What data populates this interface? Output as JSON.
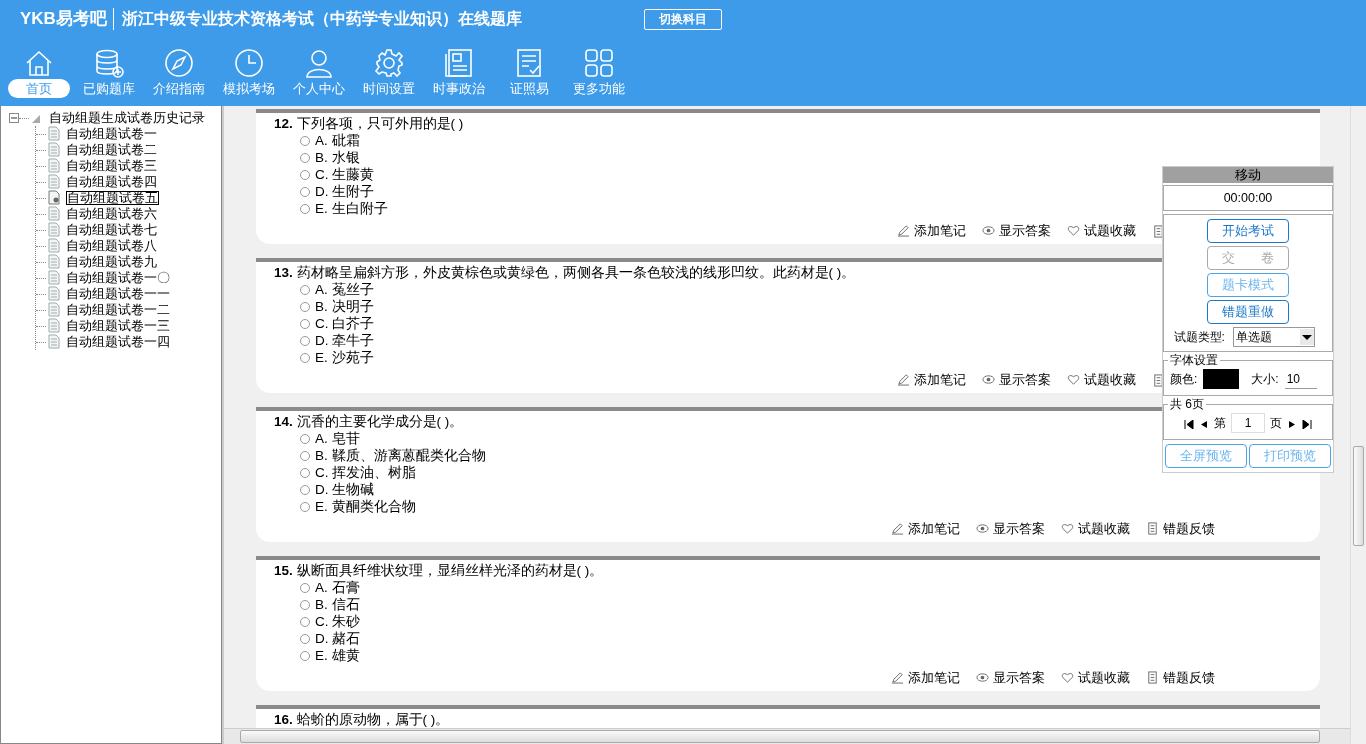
{
  "app": {
    "logo": "YKB易考吧",
    "title": "浙江中级专业技术资格考试（中药学专业知识）在线题库",
    "switch_button": "切换科目"
  },
  "nav": [
    {
      "kind": "home",
      "label": "首页",
      "selected": true
    },
    {
      "kind": "database",
      "label": "已购题库",
      "selected": false
    },
    {
      "kind": "compass",
      "label": "介绍指南",
      "selected": false
    },
    {
      "kind": "clock",
      "label": "模拟考场",
      "selected": false
    },
    {
      "kind": "person",
      "label": "个人中心",
      "selected": false
    },
    {
      "kind": "gear",
      "label": "时间设置",
      "selected": false
    },
    {
      "kind": "news",
      "label": "时事政治",
      "selected": false
    },
    {
      "kind": "checklist",
      "label": "证照易",
      "selected": false
    },
    {
      "kind": "grid",
      "label": "更多功能",
      "selected": false
    }
  ],
  "tree": {
    "label": "自动组题生成试卷历史记录",
    "expanded": true,
    "children": [
      {
        "label": "自动组题试卷一",
        "selected": false
      },
      {
        "label": "自动组题试卷二",
        "selected": false
      },
      {
        "label": "自动组题试卷三",
        "selected": false
      },
      {
        "label": "自动组题试卷四",
        "selected": false
      },
      {
        "label": "自动组题试卷五",
        "selected": true
      },
      {
        "label": "自动组题试卷六",
        "selected": false
      },
      {
        "label": "自动组题试卷七",
        "selected": false
      },
      {
        "label": "自动组题试卷八",
        "selected": false
      },
      {
        "label": "自动组题试卷九",
        "selected": false
      },
      {
        "label": "自动组题试卷一〇",
        "selected": false
      },
      {
        "label": "自动组题试卷一一",
        "selected": false
      },
      {
        "label": "自动组题试卷一二",
        "selected": false
      },
      {
        "label": "自动组题试卷一三",
        "selected": false
      },
      {
        "label": "自动组题试卷一四",
        "selected": false
      }
    ]
  },
  "questions": [
    {
      "number": "12.",
      "text": "下列各项，只可外用的是( )",
      "options": [
        {
          "letter": "A.",
          "text": "砒霜",
          "checked": false
        },
        {
          "letter": "B.",
          "text": "水银",
          "checked": false
        },
        {
          "letter": "C.",
          "text": "生藤黄",
          "checked": false
        },
        {
          "letter": "D.",
          "text": "生附子",
          "checked": false
        },
        {
          "letter": "E.",
          "text": "生白附子",
          "checked": false
        }
      ],
      "actions": [
        {
          "kind": "note",
          "label": "添加笔记"
        },
        {
          "kind": "answer",
          "label": "显示答案"
        },
        {
          "kind": "favorite",
          "label": "试题收藏"
        },
        {
          "kind": "feedback"
        }
      ]
    },
    {
      "number": "13.",
      "text": "药材略呈扁斜方形，外皮黄棕色或黄绿色，两侧各具一条色较浅的线形凹纹。此药材是( )。",
      "options": [
        {
          "letter": "A.",
          "text": "菟丝子",
          "checked": false
        },
        {
          "letter": "B.",
          "text": "决明子",
          "checked": false
        },
        {
          "letter": "C.",
          "text": "白芥子",
          "checked": false
        },
        {
          "letter": "D.",
          "text": "牵牛子",
          "checked": false
        },
        {
          "letter": "E.",
          "text": "沙苑子",
          "checked": false
        }
      ],
      "actions": [
        {
          "kind": "note",
          "label": "添加笔记"
        },
        {
          "kind": "answer",
          "label": "显示答案"
        },
        {
          "kind": "favorite",
          "label": "试题收藏"
        },
        {
          "kind": "feedback"
        }
      ]
    },
    {
      "number": "14.",
      "text": "沉香的主要化学成分是( )。",
      "options": [
        {
          "letter": "A.",
          "text": "皂苷",
          "checked": false
        },
        {
          "letter": "B.",
          "text": "鞣质、游离蒽醌类化合物",
          "checked": false
        },
        {
          "letter": "C.",
          "text": "挥发油、树脂",
          "checked": false
        },
        {
          "letter": "D.",
          "text": "生物碱",
          "checked": false
        },
        {
          "letter": "E.",
          "text": "黄酮类化合物",
          "checked": false
        }
      ],
      "actions": [
        {
          "kind": "note",
          "label": "添加笔记"
        },
        {
          "kind": "answer",
          "label": "显示答案"
        },
        {
          "kind": "favorite",
          "label": "试题收藏"
        },
        {
          "kind": "feedback",
          "label": "错题反馈"
        }
      ]
    },
    {
      "number": "15.",
      "text": "纵断面具纤维状纹理，显绢丝样光泽的药材是( )。",
      "options": [
        {
          "letter": "A.",
          "text": "石膏",
          "checked": false
        },
        {
          "letter": "B.",
          "text": "信石",
          "checked": false
        },
        {
          "letter": "C.",
          "text": "朱砂",
          "checked": false
        },
        {
          "letter": "D.",
          "text": "赭石",
          "checked": false
        },
        {
          "letter": "E.",
          "text": "雄黄",
          "checked": false
        }
      ],
      "actions": [
        {
          "kind": "note",
          "label": "添加笔记"
        },
        {
          "kind": "answer",
          "label": "显示答案"
        },
        {
          "kind": "favorite",
          "label": "试题收藏"
        },
        {
          "kind": "feedback",
          "label": "错题反馈"
        }
      ]
    },
    {
      "number": "16.",
      "text": "蛤蚧的原动物，属于( )。"
    }
  ],
  "panel": {
    "title": "移动",
    "timer": "00:00:00",
    "buttons": [
      {
        "label": "开始考试",
        "active": true,
        "disabled": false
      },
      {
        "label": "交　　卷",
        "active": false,
        "disabled": true
      },
      {
        "label": "题卡模式",
        "active": false,
        "disabled": false
      },
      {
        "label": "错题重做",
        "active": true,
        "disabled": false
      }
    ],
    "type_label": "试题类型:",
    "type_value": "单选题",
    "font_group": "字体设置",
    "color_label": "颜色:",
    "size_label": "大小:",
    "size_value": "10",
    "pages_group": "共 6页",
    "page_prefix": "第",
    "page_value": "1",
    "page_suffix": "页",
    "preview_buttons": [
      "全屏预览",
      "打印预览"
    ]
  }
}
